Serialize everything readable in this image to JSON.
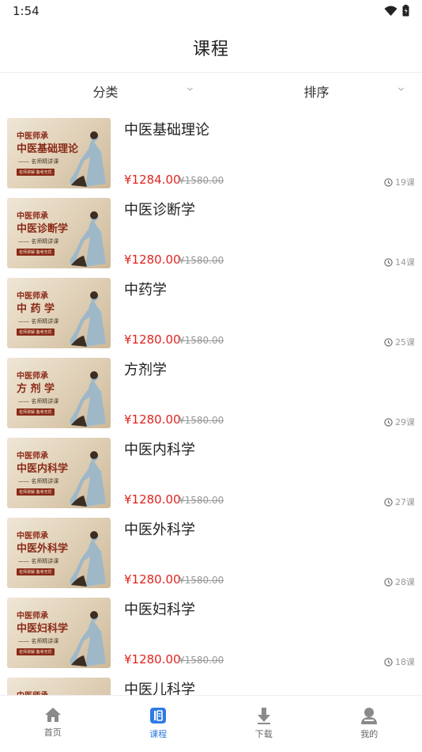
{
  "status": {
    "time": "1:54"
  },
  "header": {
    "title": "课程"
  },
  "filters": {
    "category": "分类",
    "sort": "排序"
  },
  "thumb": {
    "series": "中医师承",
    "subtitle": "—— 名师精讲课",
    "tag": "名师讲解 备考无忧"
  },
  "courses": [
    {
      "thumb_title": "中医基础理论",
      "name": "中医基础理论",
      "price": "¥1284.00",
      "orig": "¥1580.00",
      "count": "19课"
    },
    {
      "thumb_title": "中医诊断学",
      "name": "中医诊断学",
      "price": "¥1280.00",
      "orig": "¥1580.00",
      "count": "14课"
    },
    {
      "thumb_title": "中 药 学",
      "name": "中药学",
      "price": "¥1280.00",
      "orig": "¥1580.00",
      "count": "25课"
    },
    {
      "thumb_title": "方 剂 学",
      "name": "方剂学",
      "price": "¥1280.00",
      "orig": "¥1580.00",
      "count": "29课"
    },
    {
      "thumb_title": "中医内科学",
      "name": "中医内科学",
      "price": "¥1280.00",
      "orig": "¥1580.00",
      "count": "27课"
    },
    {
      "thumb_title": "中医外科学",
      "name": "中医外科学",
      "price": "¥1280.00",
      "orig": "¥1580.00",
      "count": "28课"
    },
    {
      "thumb_title": "中医妇科学",
      "name": "中医妇科学",
      "price": "¥1280.00",
      "orig": "¥1580.00",
      "count": "18课"
    },
    {
      "thumb_title": "",
      "name": "中医儿科学",
      "price": "",
      "orig": "",
      "count": ""
    }
  ],
  "tabs": [
    {
      "label": "首页",
      "icon": "home-icon"
    },
    {
      "label": "课程",
      "icon": "course-book-icon"
    },
    {
      "label": "下载",
      "icon": "download-icon"
    },
    {
      "label": "我的",
      "icon": "profile-icon"
    }
  ],
  "colors": {
    "price": "#e0241f",
    "accent": "#2f7ae5",
    "thumb_title": "#8a2a17"
  }
}
